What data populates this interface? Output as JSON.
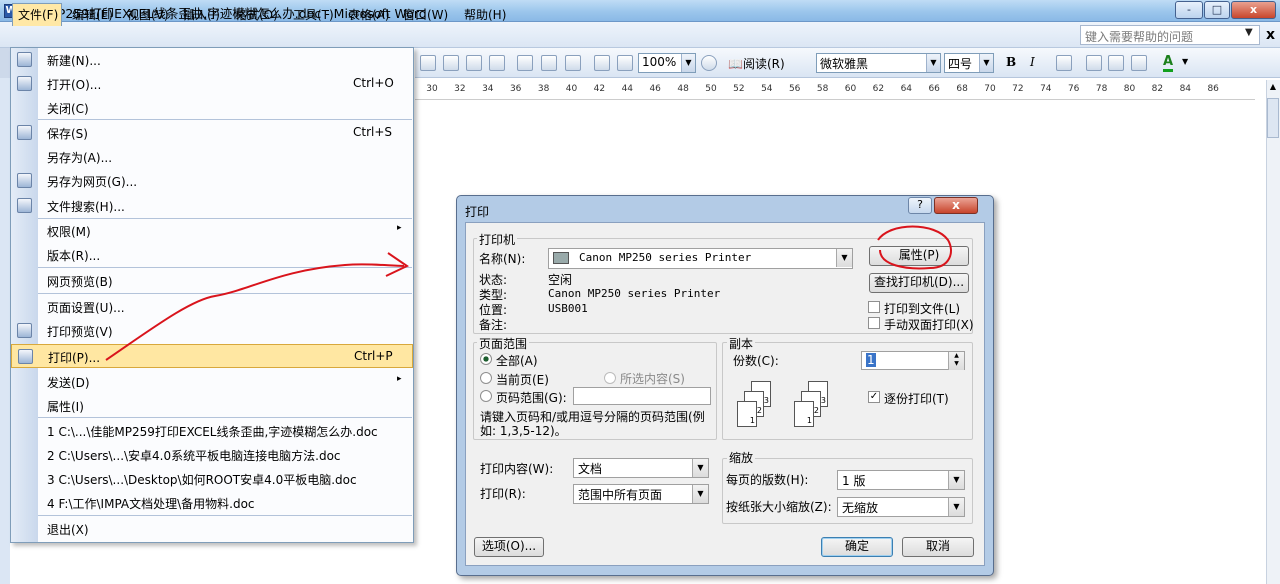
{
  "window": {
    "title": "佳能MP259打印EXCEL线条歪曲,字迹模糊怎么办.doc - Microsoft Word",
    "app_icon": "word-icon",
    "controls": [
      "-",
      "□",
      "x"
    ]
  },
  "menubar": {
    "items": [
      "文件(F)",
      "编辑(E)",
      "视图(V)",
      "插入(I)",
      "格式(O)",
      "工具(T)",
      "表格(A)",
      "窗口(W)",
      "帮助(H)"
    ],
    "help_box": "键入需要帮助的问题",
    "close": "x"
  },
  "toolbar": {
    "zoom": "100%",
    "read_label": "阅读(R)",
    "font": "微软雅黑",
    "size": "四号",
    "bold": "B",
    "italic": "I",
    "font_color": "A"
  },
  "ruler": {
    "ticks": [
      "30",
      "32",
      "34",
      "36",
      "38",
      "40",
      "42",
      "44",
      "46",
      "48",
      "50",
      "52",
      "54",
      "56",
      "58",
      "60",
      "62",
      "64",
      "66",
      "68",
      "70",
      "72",
      "74",
      "76",
      "78",
      "80",
      "82",
      "84",
      "86"
    ]
  },
  "file_menu": {
    "items": [
      {
        "label": "新建(N)...",
        "shortcut": ""
      },
      {
        "label": "打开(O)...",
        "shortcut": "Ctrl+O"
      },
      {
        "label": "关闭(C)",
        "shortcut": ""
      },
      {
        "label": "保存(S)",
        "shortcut": "Ctrl+S"
      },
      {
        "label": "另存为(A)...",
        "shortcut": ""
      },
      {
        "label": "另存为网页(G)...",
        "shortcut": ""
      },
      {
        "label": "文件搜索(H)...",
        "shortcut": ""
      },
      {
        "label": "权限(M)",
        "shortcut": ""
      },
      {
        "label": "版本(R)...",
        "shortcut": ""
      },
      {
        "label": "网页预览(B)",
        "shortcut": ""
      },
      {
        "label": "页面设置(U)...",
        "shortcut": ""
      },
      {
        "label": "打印预览(V)",
        "shortcut": ""
      },
      {
        "label": "打印(P)...",
        "shortcut": "Ctrl+P"
      },
      {
        "label": "发送(D)",
        "shortcut": ""
      },
      {
        "label": "属性(I)",
        "shortcut": ""
      },
      {
        "label": "1 C:\\...\\佳能MP259打印EXCEL线条歪曲,字迹模糊怎么办.doc",
        "shortcut": ""
      },
      {
        "label": "2 C:\\Users\\...\\安卓4.0系统平板电脑连接电脑方法.doc",
        "shortcut": ""
      },
      {
        "label": "3 C:\\Users\\...\\Desktop\\如何ROOT安卓4.0平板电脑.doc",
        "shortcut": ""
      },
      {
        "label": "4 F:\\工作\\IMPA文档处理\\备用物料.doc",
        "shortcut": ""
      },
      {
        "label": "退出(X)",
        "shortcut": ""
      }
    ],
    "submenu_arrow": "▸"
  },
  "print_dialog": {
    "title": "打印",
    "help": "?",
    "close": "x",
    "printer": {
      "group_label": "打印机",
      "name_label": "名称(N):",
      "name_value": "Canon MP250 series Printer",
      "status_label": "状态:",
      "status_value": "空闲",
      "type_label": "类型:",
      "type_value": "Canon MP250 series Printer",
      "where_label": "位置:",
      "where_value": "USB001",
      "comment_label": "备注:",
      "comment_value": "",
      "properties_button": "属性(P)",
      "find_button": "查找打印机(D)...",
      "print_to_file": "打印到文件(L)",
      "manual_duplex": "手动双面打印(X)"
    },
    "page_range": {
      "group_label": "页面范围",
      "all": "全部(A)",
      "current": "当前页(E)",
      "selection": "所选内容(S)",
      "pages": "页码范围(G):",
      "pages_value": "",
      "hint": "请键入页码和/或用逗号分隔的页码范围(例如: 1,3,5-12)。"
    },
    "copies": {
      "group_label": "副本",
      "count_label": "份数(C):",
      "count_value": "1",
      "collate": "逐份打印(T)",
      "page_labels": [
        "3",
        "2",
        "1",
        "3",
        "2",
        "1"
      ]
    },
    "print_what_label": "打印内容(W):",
    "print_what_value": "文档",
    "print_label": "打印(R):",
    "print_value": "范围中所有页面",
    "zoom": {
      "group_label": "缩放",
      "pages_per_sheet_label": "每页的版数(H):",
      "pages_per_sheet_value": "1 版",
      "scale_label": "按纸张大小缩放(Z):",
      "scale_value": "无缩放"
    },
    "options_button": "选项(O)...",
    "ok_button": "确定",
    "cancel_button": "取消"
  },
  "annotation_colors": {
    "red_marker": "#d9141c"
  }
}
